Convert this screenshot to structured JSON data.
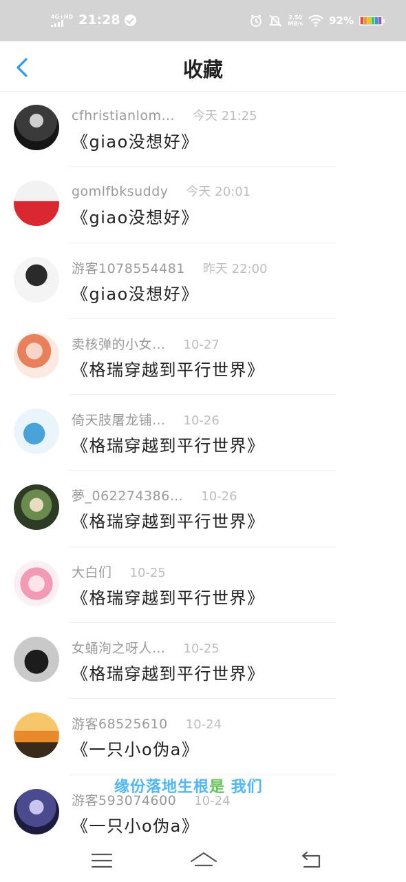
{
  "status_bar": {
    "network": "4G+HD",
    "time": "21:28",
    "speed_value": "2.50",
    "speed_unit": "MB/s",
    "battery": "92%",
    "icons": [
      "signal-icon",
      "check-circle-icon",
      "alarm-icon",
      "mute-icon",
      "wifi-icon",
      "battery-icon"
    ]
  },
  "header": {
    "title": "收藏",
    "back_icon": "chevron-left-icon",
    "accent_color": "#2b9bf0"
  },
  "favorites": [
    {
      "user": "cfhristianlom…",
      "date": "今天 21:25",
      "title": "《giao没想好》"
    },
    {
      "user": "gomlfbksuddy",
      "date": "今天 20:01",
      "title": "《giao没想好》"
    },
    {
      "user": "游客1078554481",
      "date": "昨天 22:00",
      "title": "《giao没想好》"
    },
    {
      "user": "卖核弹的小女…",
      "date": "10-27",
      "title": "《格瑞穿越到平行世界》"
    },
    {
      "user": "倚天肢屠龙铺…",
      "date": "10-26",
      "title": "《格瑞穿越到平行世界》"
    },
    {
      "user": "夢_062274386…",
      "date": "10-26",
      "title": "《格瑞穿越到平行世界》"
    },
    {
      "user": "大白们",
      "date": "10-25",
      "title": "《格瑞穿越到平行世界》"
    },
    {
      "user": "女蛹洵之呀人…",
      "date": "10-25",
      "title": "《格瑞穿越到平行世界》"
    },
    {
      "user": "游客68525610",
      "date": "10-24",
      "title": "《一只小o伪a》"
    },
    {
      "user": "游客593074600",
      "date": "10-24",
      "title": "《一只小o伪a》"
    }
  ],
  "watermark": {
    "part_a": "缘份落地生根",
    "part_b": "是",
    "part_c": " 我们"
  },
  "nav_bar": {
    "icons": [
      "menu-icon",
      "home-icon",
      "back-icon"
    ]
  }
}
